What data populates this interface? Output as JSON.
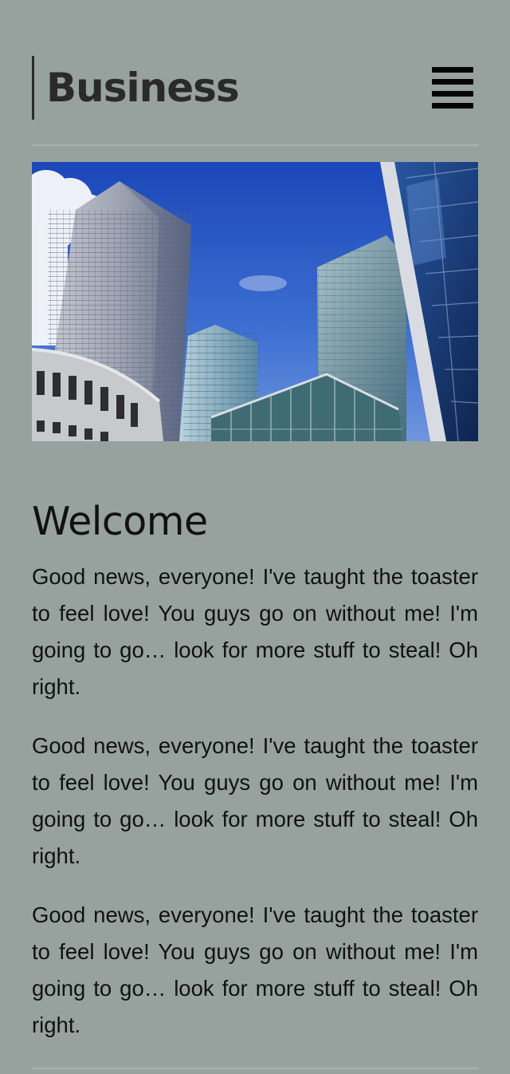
{
  "header": {
    "logo_text": "Business",
    "menu_icon": "hamburger-menu-icon"
  },
  "hero": {
    "image_subject": "glass office skyscrapers against a blue sky"
  },
  "main": {
    "heading": "Welcome",
    "paragraphs": [
      "Good news, everyone! I've taught the toaster to feel love! You guys go on without me! I'm going to go… look for more stuff to steal! Oh right.",
      "Good news, everyone! I've taught the toaster to feel love! You guys go on without me! I'm going to go… look for more stuff to steal! Oh right.",
      "Good news, everyone! I've taught the toaster to feel love! You guys go on without me! I'm going to go… look for more stuff to steal! Oh right."
    ]
  },
  "colors": {
    "background": "#97a29f",
    "rule": "#a9b3b0",
    "text": "#111111"
  }
}
